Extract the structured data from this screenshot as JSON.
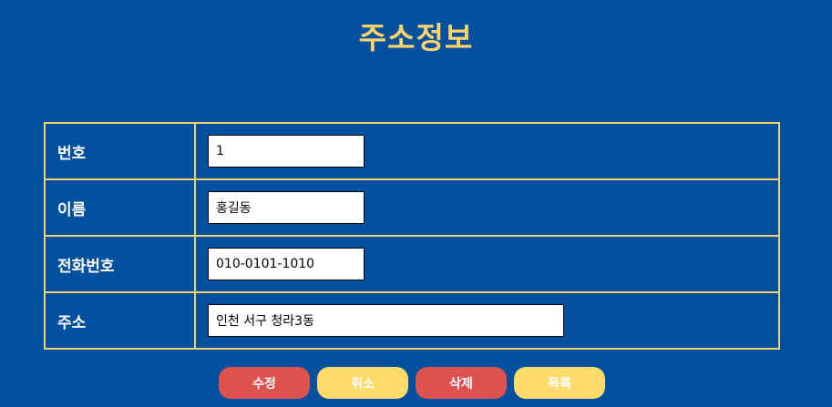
{
  "title": "주소정보",
  "form": {
    "rows": [
      {
        "label": "번호",
        "value": "1"
      },
      {
        "label": "이름",
        "value": "홍길동"
      },
      {
        "label": "전화번호",
        "value": "010-0101-1010"
      },
      {
        "label": "주소",
        "value": "인천 서구 청라3동"
      }
    ]
  },
  "buttons": {
    "edit": "수정",
    "cancel": "취소",
    "delete": "삭제",
    "list": "목록"
  },
  "colors": {
    "background": "#03519e",
    "accent": "#fdd36c",
    "border": "#f3d16e",
    "button_red": "#dd514f",
    "button_yellow": "#fedb6a"
  }
}
